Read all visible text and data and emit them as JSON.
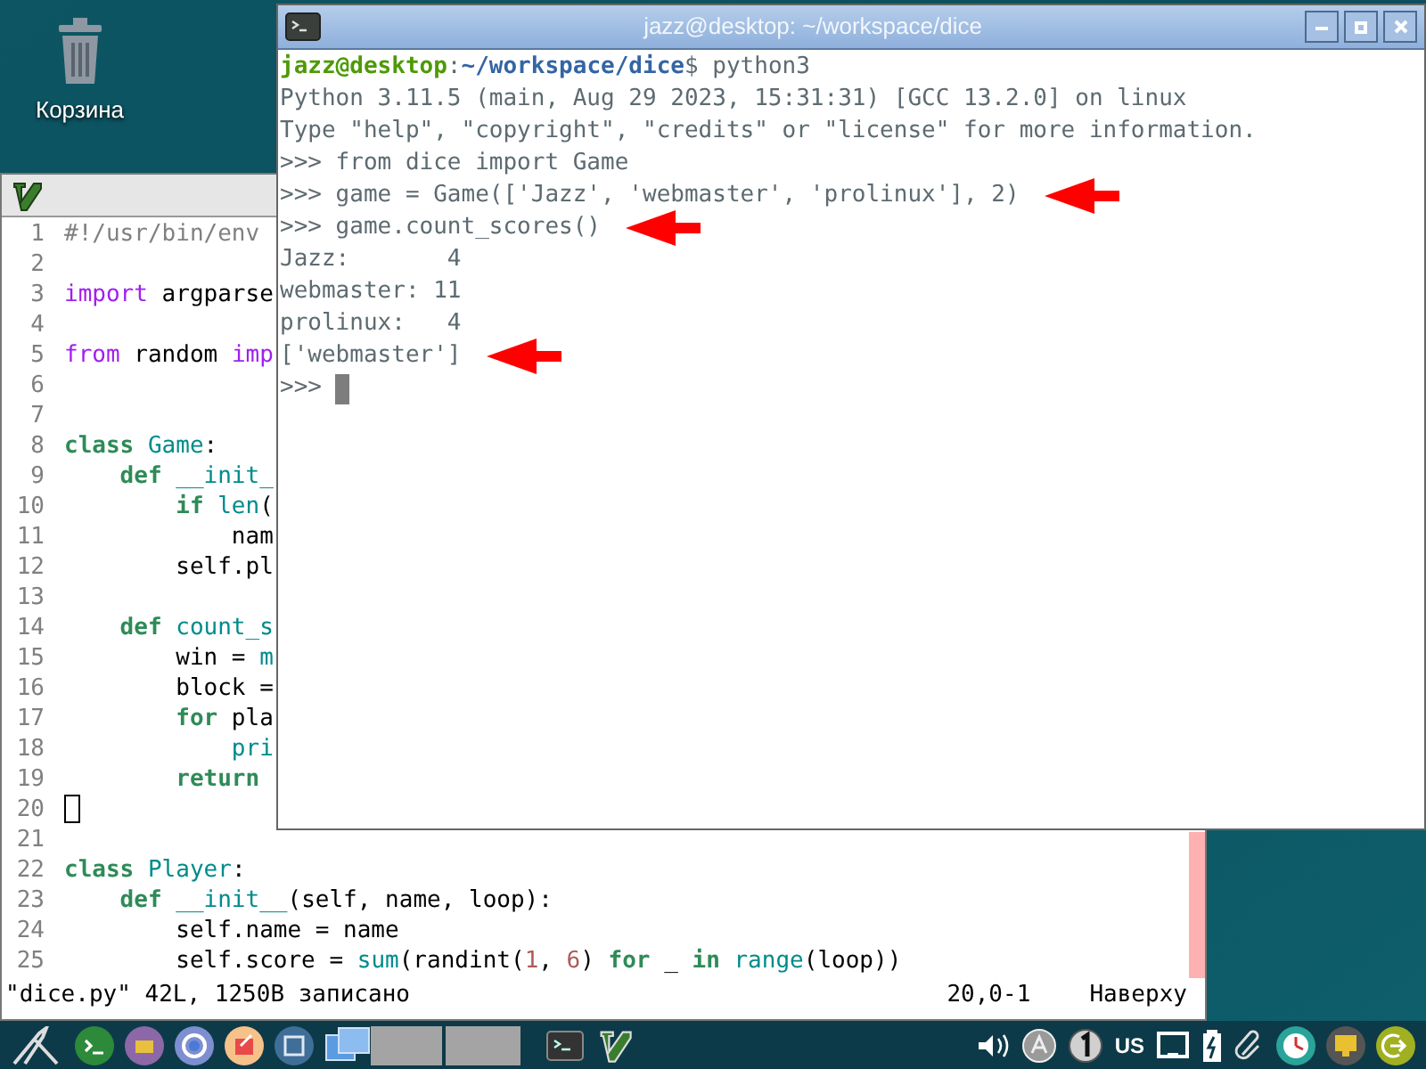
{
  "desktop": {
    "icons": [
      {
        "label": "Корзина"
      }
    ]
  },
  "editor": {
    "lines": [
      {
        "number": "1",
        "tokens": [
          {
            "kind": "comment",
            "text": "#!/usr/bin/env"
          }
        ]
      },
      {
        "number": "2"
      },
      {
        "number": "3",
        "tokens": [
          {
            "kind": "include",
            "text": "import"
          },
          {
            "kind": "plain",
            "text": " argparse"
          }
        ]
      },
      {
        "number": "4"
      },
      {
        "number": "5",
        "tokens": [
          {
            "kind": "include",
            "text": "from"
          },
          {
            "kind": "plain",
            "text": " random "
          },
          {
            "kind": "include",
            "text": "imp"
          }
        ]
      },
      {
        "number": "6"
      },
      {
        "number": "7"
      },
      {
        "number": "8",
        "tokens": [
          {
            "kind": "keyword",
            "text": "class"
          },
          {
            "kind": "name",
            "text": " Game"
          },
          {
            "kind": "plain",
            "text": ":"
          }
        ]
      },
      {
        "number": "9",
        "tokens": [
          {
            "kind": "keyword",
            "text": "    def"
          },
          {
            "kind": "name",
            "text": " __init_"
          }
        ]
      },
      {
        "number": "10",
        "tokens": [
          {
            "kind": "keyword",
            "text": "        if"
          },
          {
            "kind": "name",
            "text": " len"
          },
          {
            "kind": "plain",
            "text": "("
          }
        ]
      },
      {
        "number": "11",
        "tokens": [
          {
            "kind": "plain",
            "text": "            nam"
          }
        ]
      },
      {
        "number": "12",
        "tokens": [
          {
            "kind": "plain",
            "text": "        self.pl"
          }
        ]
      },
      {
        "number": "13"
      },
      {
        "number": "14",
        "tokens": [
          {
            "kind": "keyword",
            "text": "    def"
          },
          {
            "kind": "name",
            "text": " count_s"
          }
        ]
      },
      {
        "number": "15",
        "tokens": [
          {
            "kind": "plain",
            "text": "        win = "
          },
          {
            "kind": "name",
            "text": "m"
          }
        ]
      },
      {
        "number": "16",
        "tokens": [
          {
            "kind": "plain",
            "text": "        block ="
          }
        ]
      },
      {
        "number": "17",
        "tokens": [
          {
            "kind": "keyword",
            "text": "        for"
          },
          {
            "kind": "plain",
            "text": " pla"
          }
        ]
      },
      {
        "number": "18",
        "tokens": [
          {
            "kind": "name",
            "text": "            pri"
          }
        ]
      },
      {
        "number": "19",
        "tokens": [
          {
            "kind": "keyword",
            "text": "        return"
          }
        ]
      },
      {
        "number": "20",
        "tokens": [
          {
            "kind": "cursor"
          }
        ]
      },
      {
        "number": "21"
      },
      {
        "number": "22",
        "tokens": [
          {
            "kind": "keyword",
            "text": "class"
          },
          {
            "kind": "name",
            "text": " Player"
          },
          {
            "kind": "plain",
            "text": ":"
          }
        ]
      },
      {
        "number": "23",
        "tokens": [
          {
            "kind": "keyword",
            "text": "    def"
          },
          {
            "kind": "name",
            "text": " __init__"
          },
          {
            "kind": "plain",
            "text": "(self, name, loop):"
          }
        ]
      },
      {
        "number": "24",
        "tokens": [
          {
            "kind": "plain",
            "text": "        self.name = name"
          }
        ]
      },
      {
        "number": "25",
        "tokens": [
          {
            "kind": "plain",
            "text": "        self.score = "
          },
          {
            "kind": "name",
            "text": "sum"
          },
          {
            "kind": "plain",
            "text": "(randint("
          },
          {
            "kind": "number",
            "text": "1"
          },
          {
            "kind": "plain",
            "text": ", "
          },
          {
            "kind": "number",
            "text": "6"
          },
          {
            "kind": "plain",
            "text": ") "
          },
          {
            "kind": "keyword",
            "text": "for"
          },
          {
            "kind": "plain",
            "text": " _ "
          },
          {
            "kind": "keyword",
            "text": "in"
          },
          {
            "kind": "name",
            "text": " range"
          },
          {
            "kind": "plain",
            "text": "(loop))"
          }
        ]
      }
    ],
    "status": {
      "message": "\"dice.py\" 42L, 1250B записано",
      "position": "20,0-1",
      "scroll": "Наверху"
    }
  },
  "terminal": {
    "title": "jazz@desktop: ~/workspace/dice",
    "prompt": {
      "user": "jazz@desktop",
      "separator": ":",
      "path": "~/workspace/dice",
      "command": "$ python3"
    },
    "lines": [
      {
        "text": "Python 3.11.5 (main, Aug 29 2023, 15:31:31) [GCC 13.2.0] on linux",
        "arrow": false,
        "cursor": false
      },
      {
        "text": "Type \"help\", \"copyright\", \"credits\" or \"license\" for more information.",
        "arrow": false,
        "cursor": false
      },
      {
        "text": ">>> from dice import Game",
        "arrow": false,
        "cursor": false
      },
      {
        "text": ">>> game = Game(['Jazz', 'webmaster', 'prolinux'], 2)",
        "arrow": true,
        "cursor": false
      },
      {
        "text": ">>> game.count_scores()",
        "arrow": true,
        "cursor": false
      },
      {
        "text": "Jazz:       4",
        "arrow": false,
        "cursor": false
      },
      {
        "text": "webmaster: 11",
        "arrow": false,
        "cursor": false
      },
      {
        "text": "prolinux:   4",
        "arrow": false,
        "cursor": false
      },
      {
        "text": "['webmaster']",
        "arrow": true,
        "cursor": false
      },
      {
        "text": ">>>",
        "arrow": false,
        "cursor": true
      }
    ]
  },
  "taskbar": {
    "keyboard_layout": "US"
  }
}
